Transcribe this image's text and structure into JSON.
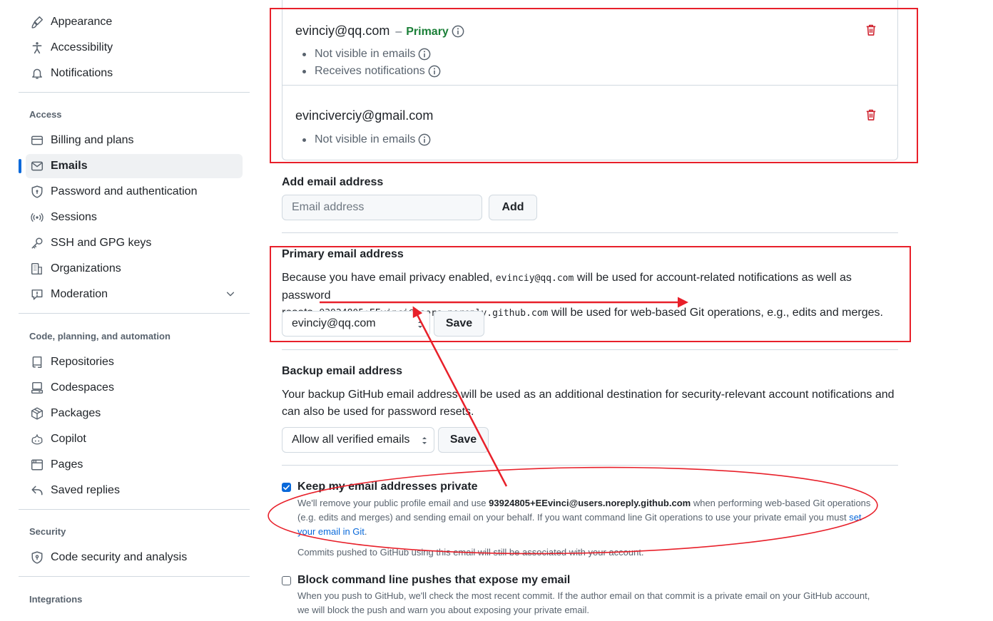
{
  "sidebar": {
    "top_items": [
      {
        "label": "Appearance",
        "icon": "paintbrush-icon"
      },
      {
        "label": "Accessibility",
        "icon": "accessibility-icon"
      },
      {
        "label": "Notifications",
        "icon": "bell-icon"
      }
    ],
    "access": {
      "heading": "Access",
      "items": [
        {
          "label": "Billing and plans",
          "icon": "credit-card-icon"
        },
        {
          "label": "Emails",
          "icon": "mail-icon",
          "active": true
        },
        {
          "label": "Password and authentication",
          "icon": "shield-lock-icon"
        },
        {
          "label": "Sessions",
          "icon": "broadcast-icon"
        },
        {
          "label": "SSH and GPG keys",
          "icon": "key-icon"
        },
        {
          "label": "Organizations",
          "icon": "organization-icon"
        },
        {
          "label": "Moderation",
          "icon": "report-icon"
        }
      ]
    },
    "code": {
      "heading": "Code, planning, and automation",
      "items": [
        {
          "label": "Repositories",
          "icon": "repo-icon"
        },
        {
          "label": "Codespaces",
          "icon": "codespaces-icon"
        },
        {
          "label": "Packages",
          "icon": "package-icon"
        },
        {
          "label": "Copilot",
          "icon": "copilot-icon"
        },
        {
          "label": "Pages",
          "icon": "browser-icon"
        },
        {
          "label": "Saved replies",
          "icon": "reply-icon"
        }
      ]
    },
    "security": {
      "heading": "Security",
      "items": [
        {
          "label": "Code security and analysis",
          "icon": "shield-icon"
        }
      ]
    },
    "integrations": {
      "heading": "Integrations"
    }
  },
  "emails": [
    {
      "address": "evinciy@qq.com",
      "primary_label": "Primary",
      "bullets": [
        "Not visible in emails",
        "Receives notifications"
      ]
    },
    {
      "address": "evinciverciy@gmail.com",
      "bullets": [
        "Not visible in emails"
      ]
    }
  ],
  "add_email": {
    "title": "Add email address",
    "placeholder": "Email address",
    "button": "Add"
  },
  "primary_email": {
    "title": "Primary email address",
    "text_1": "Because you have email privacy enabled,",
    "code_1": "evinciy@qq.com",
    "text_2": "will be used for account-related notifications as well as password",
    "text_3": "resets.",
    "code_2": "93924805+EEvinci@users.noreply.github.com",
    "text_4": "will be used for web-based Git operations, e.g., edits and merges.",
    "selected": "evinciy@qq.com",
    "button": "Save"
  },
  "backup_email": {
    "title": "Backup email address",
    "text_line1": "Your backup GitHub email address will be used as an additional destination for security-relevant account notifications and",
    "text_line2": "can also be used for password resets.",
    "selected": "Allow all verified emails",
    "button": "Save"
  },
  "keep_private": {
    "checked": true,
    "label": "Keep my email addresses private",
    "desc_1": "We'll remove your public profile email and use",
    "desc_email": "93924805+EEvinci@users.noreply.github.com",
    "desc_2": "when performing web-based Git operations",
    "desc_line2": "(e.g. edits and merges) and sending email on your behalf. If you want command line Git operations to use your private email you must",
    "desc_link_1": "set",
    "desc_link_2": "your email in Git",
    "desc_end": ".",
    "note": "Commits pushed to GitHub using this email will still be associated with your account."
  },
  "block_push": {
    "checked": false,
    "label": "Block command line pushes that expose my email",
    "desc_line1": "When you push to GitHub, we'll check the most recent commit. If the author email on that commit is a private email on your GitHub account,",
    "desc_line2": "we will block the push and warn you about exposing your private email."
  },
  "colors": {
    "accent": "#0969da",
    "success": "#1a7f37",
    "danger": "#cf222e",
    "annotation": "#e8202a"
  }
}
